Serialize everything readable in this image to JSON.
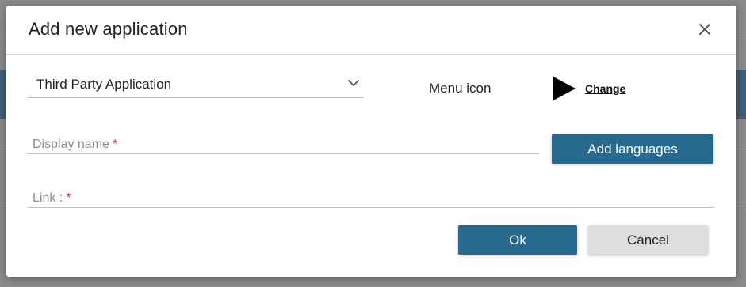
{
  "dialog": {
    "title": "Add new application",
    "close_icon": "close-icon"
  },
  "form": {
    "application_type": {
      "value": "Third Party Application",
      "icon": "chevron-down-icon"
    },
    "menu_icon": {
      "label": "Menu icon",
      "preview_icon": "play-triangle-icon",
      "change_label": "Change"
    },
    "display_name": {
      "placeholder": "Display name",
      "required_mark": "*"
    },
    "add_languages_label": "Add languages",
    "link": {
      "placeholder": "Link :",
      "required_mark": "*"
    }
  },
  "actions": {
    "ok_label": "Ok",
    "cancel_label": "Cancel"
  },
  "colors": {
    "primary": "#27698f",
    "required": "#d8353f",
    "overlay": "#7a7a7a"
  }
}
